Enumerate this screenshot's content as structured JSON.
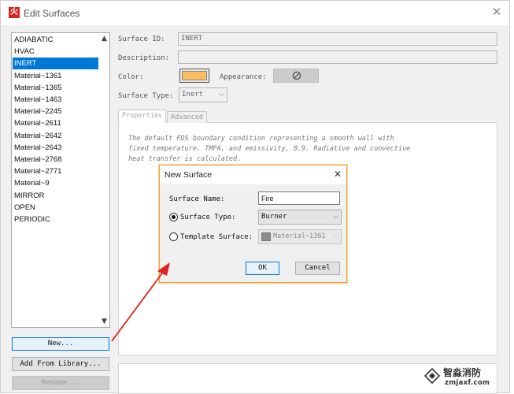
{
  "window": {
    "app_icon": "火",
    "title": "Edit Surfaces",
    "close_icon": "close-icon"
  },
  "surface_list": {
    "items": [
      {
        "label": "ADIABATIC",
        "selected": false
      },
      {
        "label": "HVAC",
        "selected": false
      },
      {
        "label": "INERT",
        "selected": true
      },
      {
        "label": "Material~1361",
        "selected": false
      },
      {
        "label": "Material~1365",
        "selected": false
      },
      {
        "label": "Material~1463",
        "selected": false
      },
      {
        "label": "Material~2245",
        "selected": false
      },
      {
        "label": "Material~2611",
        "selected": false
      },
      {
        "label": "Material~2642",
        "selected": false
      },
      {
        "label": "Material~2643",
        "selected": false
      },
      {
        "label": "Material~2768",
        "selected": false
      },
      {
        "label": "Material~2771",
        "selected": false
      },
      {
        "label": "Material~9",
        "selected": false
      },
      {
        "label": "MIRROR",
        "selected": false
      },
      {
        "label": "OPEN",
        "selected": false
      },
      {
        "label": "PERIODIC",
        "selected": false
      }
    ],
    "scroll_up": "▲",
    "scroll_down": "▼"
  },
  "buttons": {
    "new": "New...",
    "add_from_library": "Add From Library...",
    "rename": "Rename..."
  },
  "form": {
    "surface_id_label": "Surface ID:",
    "surface_id_value": "INERT",
    "description_label": "Description:",
    "description_value": "",
    "color_label": "Color:",
    "color_value": "#fcbe5f",
    "appearance_label": "Appearance:",
    "appearance_icon": "prohibited-icon",
    "surface_type_label": "Surface Type:",
    "surface_type_value": "Inert",
    "dropdown_icon": "chevron-down-icon"
  },
  "tabs": {
    "properties": "Properties",
    "advanced": "Advanced"
  },
  "properties_text": "The default FDS boundary condition representing a smooth wall with fixed temperature, TMPA, and emissivity, 0.9. Radiative and convective heat transfer is calculated.",
  "dialog": {
    "title": "New Surface",
    "surface_name_label": "Surface Name:",
    "surface_name_value": "Fire",
    "surface_type_label": "Surface Type:",
    "surface_type_value": "Burner",
    "surface_type_checked": true,
    "template_label": "Template Surface:",
    "template_value": "Material~1361",
    "template_checked": false,
    "ok": "OK",
    "cancel": "Cancel"
  },
  "annotation": {
    "arrow_color": "#e02020"
  },
  "watermark": {
    "name": "智淼消防",
    "site": "zmjaxf.com"
  }
}
